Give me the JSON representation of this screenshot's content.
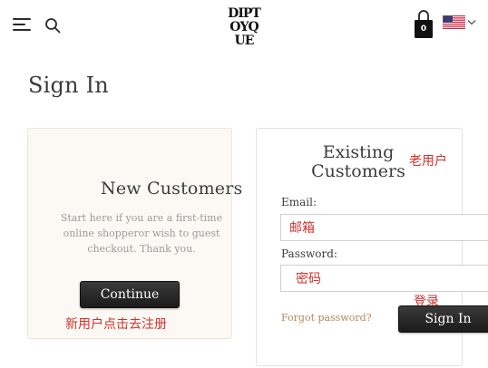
{
  "header": {
    "logo_lines": [
      "DIPT",
      "OYQ",
      "UE"
    ],
    "cart_count": "0",
    "icons": {
      "menu": "hamburger-icon",
      "search": "search-icon",
      "cart": "shopping-bag-icon",
      "flag": "us-flag-icon",
      "locale_dropdown": "chevron-down-icon"
    }
  },
  "page": {
    "title": "Sign In"
  },
  "new_customers": {
    "title": "New Customers",
    "description": "Start here if you are a first-time online shopperor wish to guest checkout. Thank you.",
    "continue_label": "Continue",
    "annotation": "新用户点击去注册"
  },
  "existing_customers": {
    "title": "Existing Customers",
    "annotation": "老用户",
    "email_label": "Email:",
    "email_value": "邮箱",
    "password_label": "Password:",
    "password_value": "密码",
    "forgot_label": "Forgot password?",
    "signin_annotation": "登录",
    "signin_label": "Sign In"
  },
  "colors": {
    "annotation": "#d0312d",
    "button": "#222222",
    "panel_bg": "#fcf9f4",
    "link": "#b28a5c"
  }
}
